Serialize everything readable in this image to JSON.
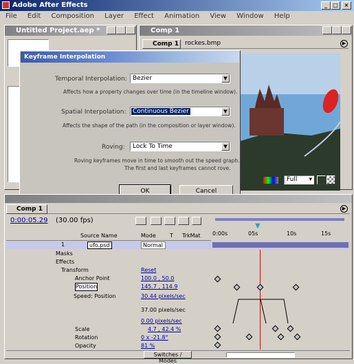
{
  "app": {
    "title": "Adobe After Effects",
    "menu": [
      "File",
      "Edit",
      "Composition",
      "Layer",
      "Effect",
      "Animation",
      "View",
      "Window",
      "Help"
    ]
  },
  "project": {
    "title": "Untitled Project.aep *"
  },
  "comp": {
    "title": "Comp 1",
    "tab_comp": "Comp 1",
    "tab_footage": "rockes.bmp",
    "zoom_label": "Full"
  },
  "dialog": {
    "title": "Keyframe Interpolation",
    "temporal_label": "Temporal Interpolation:",
    "temporal_value": "Bezier",
    "temporal_desc": "Affects how a property changes over time (in the timeline window).",
    "spatial_label": "Spatial Interpolation:",
    "spatial_value": "Continuous Bezier",
    "spatial_desc": "Affects the shape of the path (in the composition or layer window).",
    "roving_label": "Roving:",
    "roving_value": "Lock To Time",
    "roving_desc1": "Roving keyframes move in time to smooth out the speed graph.",
    "roving_desc2": "The first and last keyframes cannot rove.",
    "ok": "OK",
    "cancel": "Cancel"
  },
  "timeline": {
    "tab": "Comp 1",
    "time": "0:00:05.29",
    "fps": "(30.00 fps)",
    "col_source": "Source Name",
    "col_mode": "Mode",
    "col_t": "T",
    "col_trkmat": "TrkMat",
    "ruler": [
      "0:00s",
      "05s",
      "10s",
      "15s"
    ],
    "layer_num": "1",
    "layer_name": "ufo.psd",
    "layer_mode": "Normal",
    "rows": {
      "masks": "Masks",
      "effects": "Effects",
      "transform": "Transform",
      "reset": "Reset",
      "anchor": "Anchor Point",
      "anchor_val": "100.0 , 50.0",
      "position": "Position",
      "position_val": "145.7 , 114.9",
      "speed": "Speed: Position",
      "speed_val": "30.44 pixels/sec",
      "speed_hi": "37.00 pixels/sec",
      "speed_lo": "0.00 pixels/sec",
      "scale": "Scale",
      "scale_val": "4.7 , 42.4 %",
      "rotation": "Rotation",
      "rotation_val": "0 x -21.8°",
      "opacity": "Opacity",
      "opacity_val": "81 %"
    },
    "switches_label": "Switches / Modes"
  }
}
